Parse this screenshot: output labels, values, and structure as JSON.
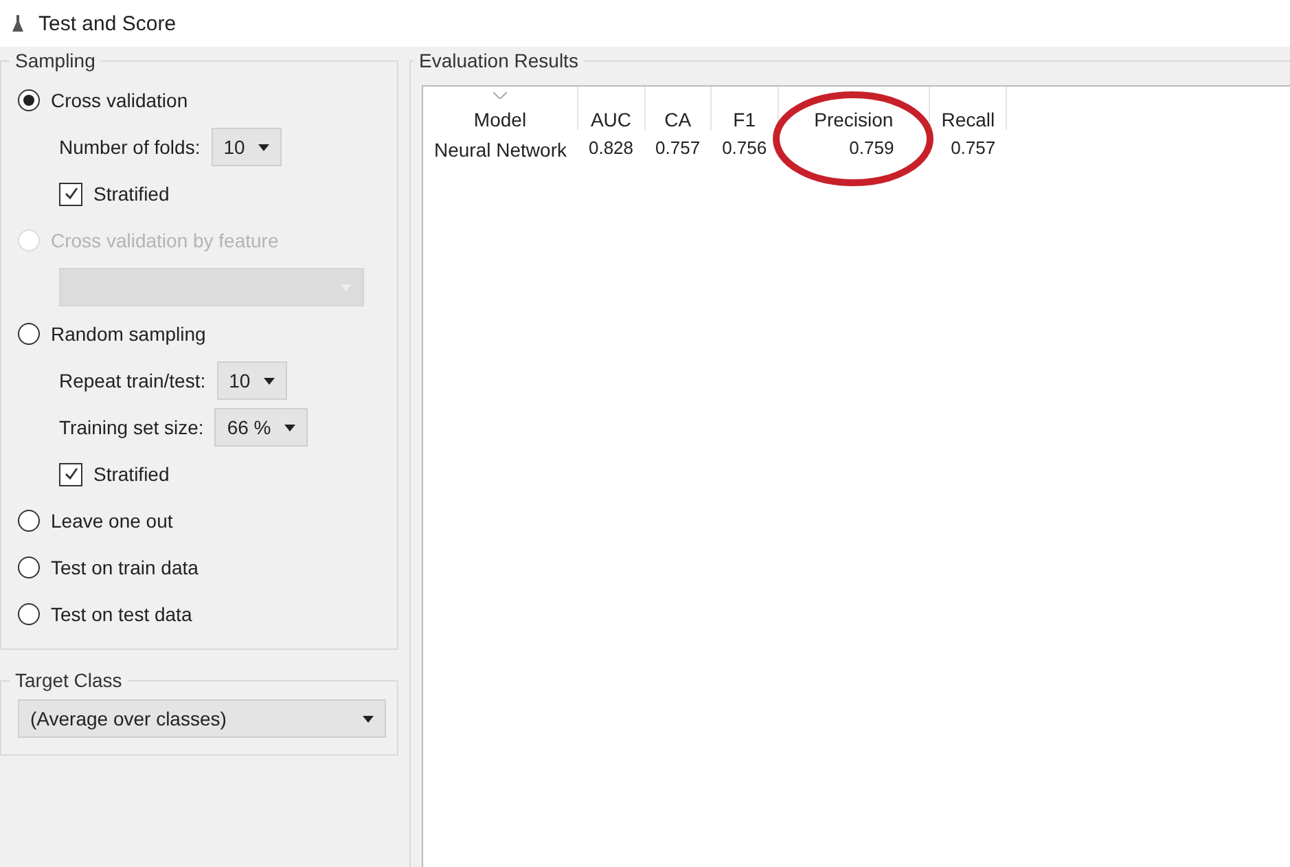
{
  "window": {
    "title": "Test and Score"
  },
  "sampling": {
    "title": "Sampling",
    "items": [
      {
        "kind": "radio",
        "label": "Cross validation",
        "selected": true,
        "disabled": false
      },
      {
        "kind": "dropdown",
        "label": "Number of folds:",
        "value": "10",
        "disabled": false
      },
      {
        "kind": "checkbox",
        "label": "Stratified",
        "checked": true
      },
      {
        "kind": "radio",
        "label": "Cross validation by feature",
        "selected": false,
        "disabled": true
      },
      {
        "kind": "dropdown",
        "disabled": true
      },
      {
        "kind": "radio",
        "label": "Random sampling",
        "selected": false,
        "disabled": false
      },
      {
        "kind": "dropdown",
        "label": "Repeat train/test:",
        "value": "10",
        "disabled": false
      },
      {
        "kind": "dropdown",
        "label": "Training set size:",
        "value": "66 %",
        "disabled": false
      },
      {
        "kind": "checkbox",
        "label": "Stratified",
        "checked": true
      },
      {
        "kind": "radio",
        "label": "Leave one out",
        "selected": false,
        "disabled": false
      },
      {
        "kind": "radio",
        "label": "Test on train data",
        "selected": false,
        "disabled": false
      },
      {
        "kind": "radio",
        "label": "Test on test data",
        "selected": false,
        "disabled": false
      }
    ]
  },
  "target_class": {
    "title": "Target Class",
    "value": "(Average over classes)"
  },
  "results": {
    "title": "Evaluation Results",
    "columns": [
      {
        "label": "Model",
        "circled": false
      },
      {
        "label": "AUC",
        "circled": false
      },
      {
        "label": "CA",
        "circled": false
      },
      {
        "label": "F1",
        "circled": false
      },
      {
        "label": "Precision",
        "circled": true
      },
      {
        "label": "Recall",
        "circled": false
      }
    ],
    "rows": [
      {
        "cells": [
          "Neural Network",
          "0.828",
          "0.757",
          "0.756",
          "0.759",
          "0.757"
        ]
      }
    ]
  }
}
